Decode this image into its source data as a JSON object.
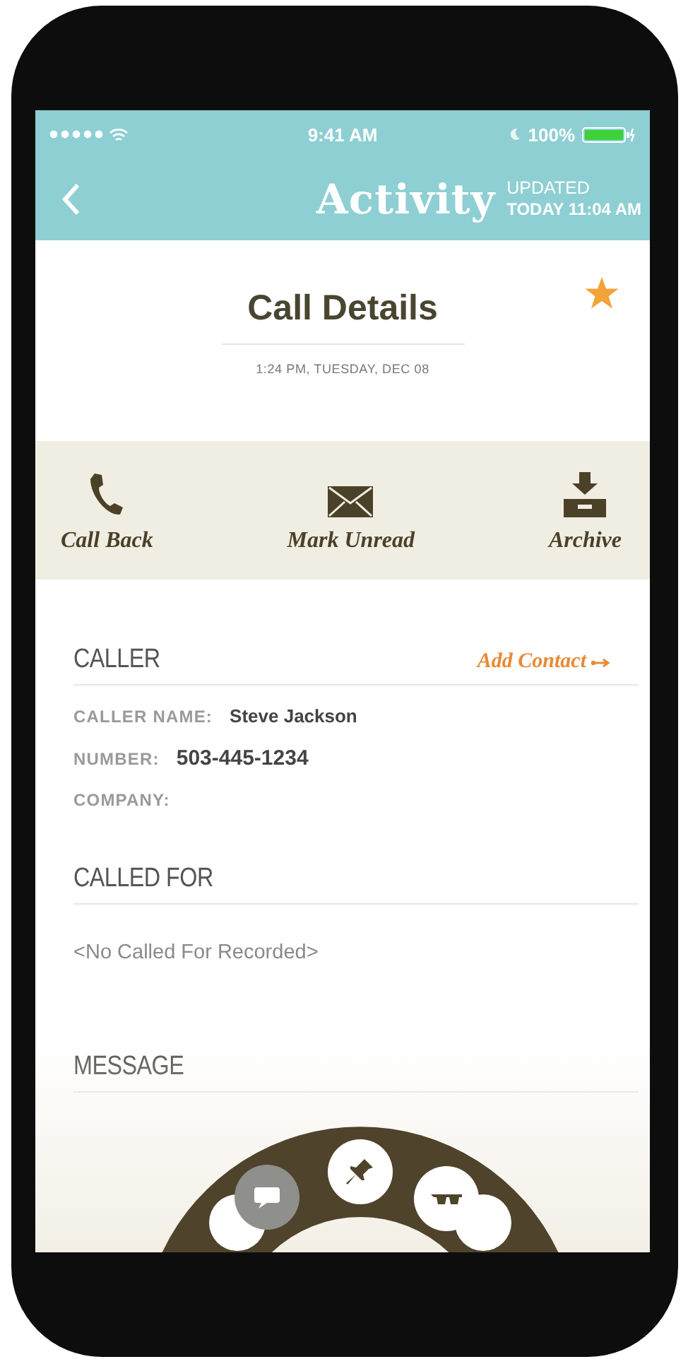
{
  "status_bar": {
    "time": "9:41 AM",
    "battery": "100%"
  },
  "nav_bar": {
    "title": "Activity",
    "updated_label": "UPDATED",
    "updated_time": "TODAY 11:04 AM"
  },
  "header": {
    "title": "Call Details",
    "datetime": "1:24 PM, TUESDAY, DEC 08",
    "favorite": true
  },
  "actions": [
    {
      "kind": "phone",
      "label": "Call Back"
    },
    {
      "kind": "envelope",
      "label": "Mark Unread"
    },
    {
      "kind": "archive",
      "label": "Archive"
    }
  ],
  "caller": {
    "heading": "CALLER",
    "link": "Add Contact",
    "fields": [
      {
        "label": "CALLER NAME:",
        "value": "Steve Jackson"
      },
      {
        "label": "NUMBER:",
        "value": "503-445-1234"
      },
      {
        "label": "COMPANY:"
      }
    ]
  },
  "called_for": {
    "heading": "CALLED FOR",
    "placeholder": "<No Called For Recorded>"
  },
  "message": {
    "heading": "MESSAGE"
  },
  "dial_menu": {
    "items": [
      {
        "kind": "other",
        "selected": false
      },
      {
        "kind": "chat",
        "selected": true
      },
      {
        "kind": "pin",
        "selected": false
      },
      {
        "kind": "glasses",
        "selected": false
      },
      {
        "kind": "other",
        "selected": false
      }
    ]
  }
}
